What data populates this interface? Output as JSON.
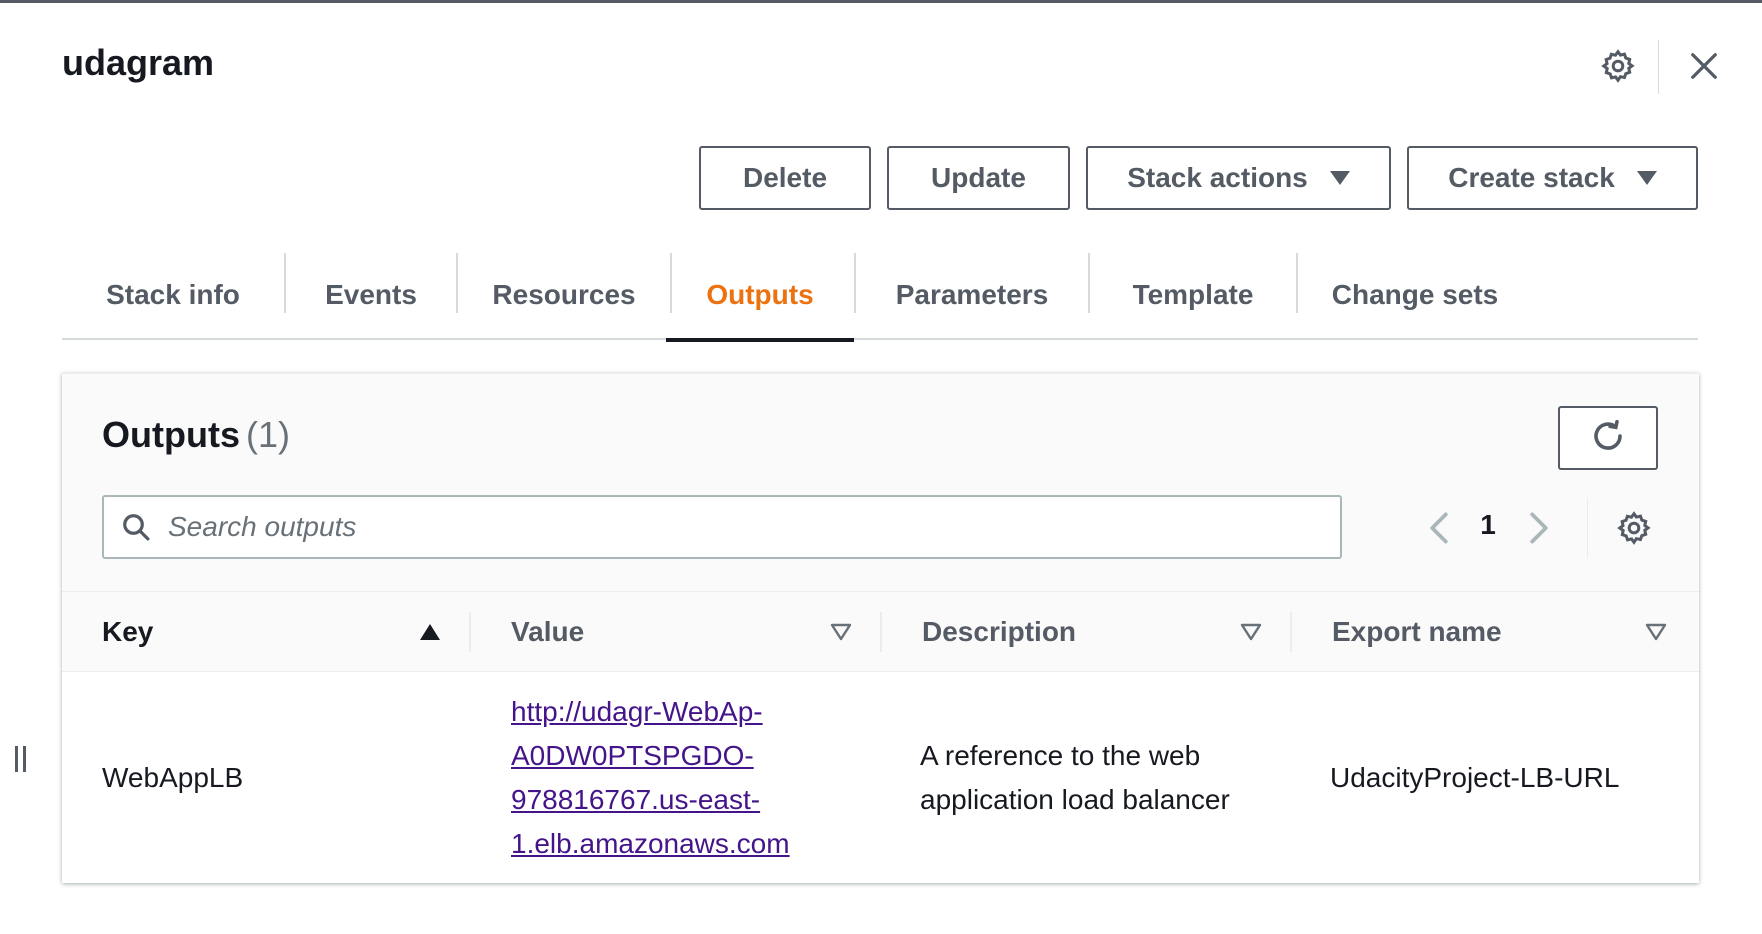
{
  "header": {
    "title": "udagram",
    "settings_icon": "gear-icon",
    "close_icon": "close-icon"
  },
  "actions": {
    "delete_label": "Delete",
    "update_label": "Update",
    "stack_actions_label": "Stack actions",
    "create_stack_label": "Create stack"
  },
  "tabs": [
    {
      "label": "Stack info",
      "active": false
    },
    {
      "label": "Events",
      "active": false
    },
    {
      "label": "Resources",
      "active": false
    },
    {
      "label": "Outputs",
      "active": true
    },
    {
      "label": "Parameters",
      "active": false
    },
    {
      "label": "Template",
      "active": false
    },
    {
      "label": "Change sets",
      "active": false
    }
  ],
  "outputs": {
    "title": "Outputs",
    "count": "(1)",
    "refresh_icon": "refresh-icon",
    "search_placeholder": "Search outputs",
    "search_value": "",
    "page": "1",
    "columns": [
      "Key",
      "Value",
      "Description",
      "Export name"
    ],
    "sorted_column": "Key",
    "sort_direction": "ascending",
    "rows": [
      {
        "key": "WebAppLB",
        "value": "http://udagr-WebAp-A0DW0PTSPGDO-978816767.us-east-1.elb.amazonaws.com",
        "value_lines": [
          "http://udagr-WebAp-",
          "A0DW0PTSPGDO-",
          "978816767.us-east-",
          "1.elb.amazonaws.com"
        ],
        "description": "A reference to the web application load balancer",
        "export_name": "UdacityProject-LB-URL"
      }
    ]
  },
  "colors": {
    "active_tab": "#ec7211",
    "link": "#44148a",
    "text": "#16191f",
    "secondary_text": "#545b64",
    "border": "#d5dbdb"
  }
}
